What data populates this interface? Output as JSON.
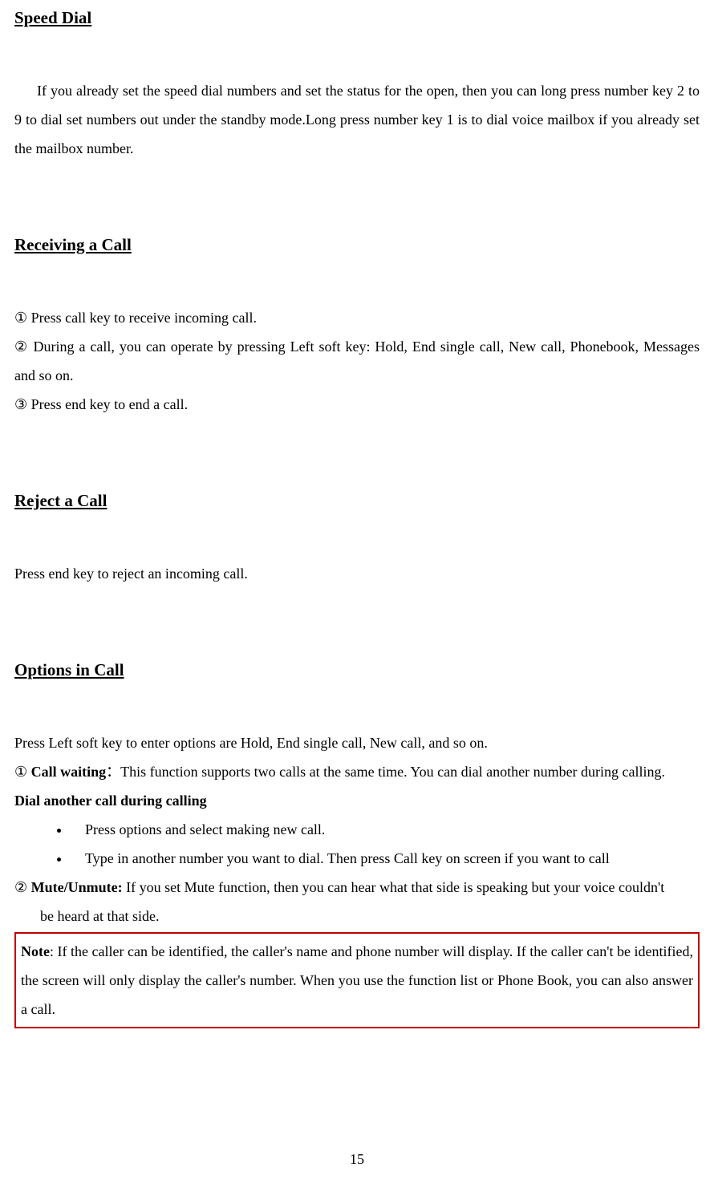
{
  "sections": {
    "speedDial": {
      "heading": "Speed Dial",
      "body": "If you already set the speed dial numbers and set the status for the open, then you can long press number key 2 to 9 to dial set numbers out under the standby mode.Long press number key 1 is to dial voice mailbox if you already set the mailbox number."
    },
    "receivingCall": {
      "heading": "Receiving a Call",
      "item1": "① Press call key to receive incoming call.",
      "item2": "② During a call, you can operate by pressing Left soft key: Hold, End single call, New call, Phonebook, Messages and so on.",
      "item3": "③ Press end key to end a call."
    },
    "rejectCall": {
      "heading": "Reject a Call",
      "body": "Press end key to reject an incoming call."
    },
    "optionsInCall": {
      "heading": "Options in Call",
      "intro": "Press Left soft key to enter options are Hold, End single call, New call, and so on.",
      "callWaitingPrefix": "① ",
      "callWaitingLabel": "Call waiting",
      "callWaitingColon": "：",
      "callWaitingBody": "This function supports two calls at the same time. You can dial another number during calling.",
      "dialAnotherHeading": "Dial another call during calling",
      "bullet1": "Press options and select making new call.",
      "bullet2": "Type in another number you want to dial. Then press Call key on screen if you want to call",
      "mutePrefix": "② ",
      "muteLabel": "Mute/Unmute: ",
      "muteBody": "If you set Mute function, then you can hear what that side is speaking but your voice couldn't",
      "muteBody2": "be heard at that side.",
      "noteLabel": "Note",
      "noteBody": ": If the caller can be identified, the caller's name and phone number will display. If the caller can't be identified, the screen will only display the caller's number. When you use the function list or Phone Book, you can also answer a call."
    }
  },
  "pageNumber": "15"
}
